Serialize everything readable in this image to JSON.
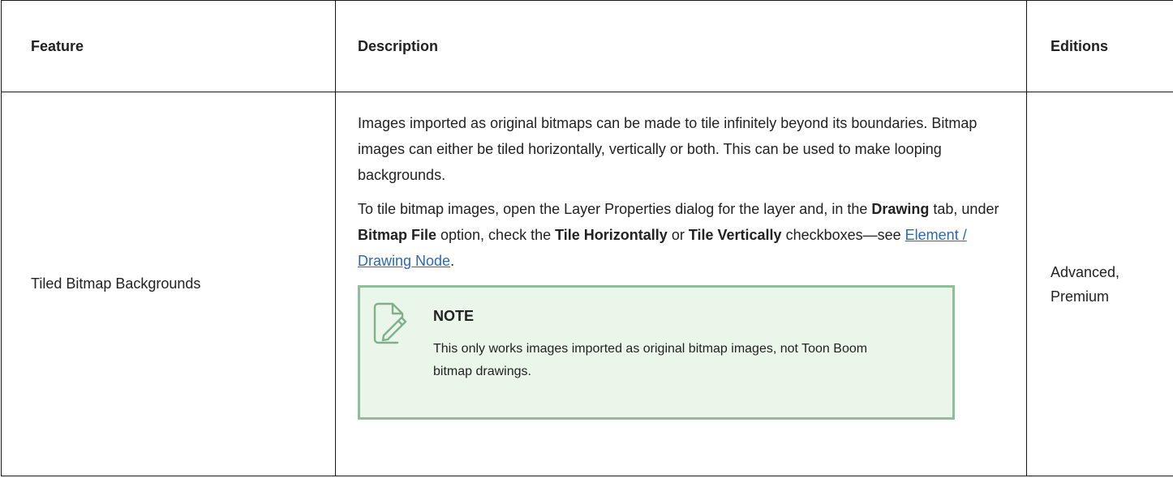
{
  "table": {
    "headers": {
      "feature": "Feature",
      "description": "Description",
      "editions": "Editions"
    },
    "row": {
      "feature": "Tiled Bitmap Backgrounds",
      "description": {
        "p1": "Images imported as original bitmaps can be made to tile infinitely beyond its boundaries. Bitmap images can either be tiled horizontally, vertically or both. This can be used to make looping backgrounds.",
        "p2_part1": "To tile bitmap images, open the Layer Properties dialog for the layer and, in the ",
        "p2_bold1": "Drawing",
        "p2_part2": " tab, under ",
        "p2_bold2": "Bitmap File",
        "p2_part3": " option, check the ",
        "p2_bold3": "Tile Horizontally",
        "p2_part4": " or ",
        "p2_bold4": "Tile Vertically",
        "p2_part5": " checkboxes—see ",
        "p2_link": "Element / Drawing Node",
        "p2_end": ".",
        "note": {
          "icon": "note-pencil-icon",
          "title": "NOTE",
          "text": "This only works images imported as original bitmap images, not Toon Boom bitmap drawings."
        }
      },
      "editions_line1": "Advanced,",
      "editions_line2": "Premium"
    }
  },
  "colors": {
    "link": "#2a6ab3",
    "note_background": "#eaf6ea",
    "note_border": "#8fbf9a",
    "icon_stroke": "#7fb08a"
  }
}
